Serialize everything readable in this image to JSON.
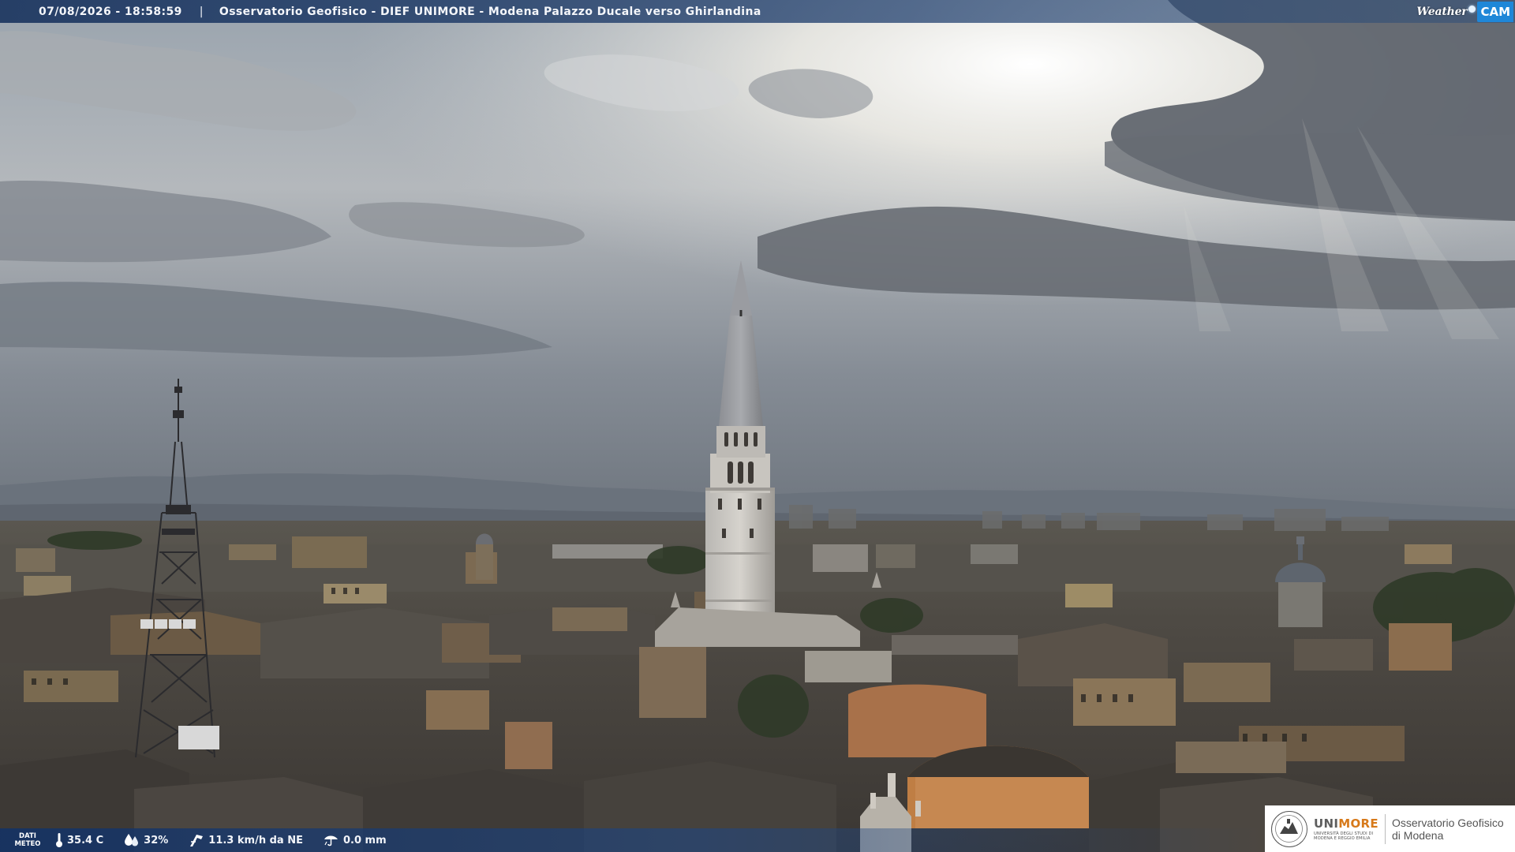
{
  "overlay": {
    "timestamp": "07/08/2026 - 18:58:59",
    "separator": "|",
    "camera_title": "Osservatorio Geofisico - DIEF UNIMORE - Modena Palazzo Ducale verso Ghirlandina"
  },
  "brand": {
    "weather": "Weather",
    "cam": "CAM"
  },
  "meteo": {
    "label_line1": "DATI",
    "label_line2": "METEO",
    "temperature": "35.4 C",
    "humidity": "32%",
    "wind": "11.3 km/h da NE",
    "rain": "0.0 mm"
  },
  "logo": {
    "uni_part1": "UNI",
    "uni_part2": "MORE",
    "uni_sub1": "Università degli studi di",
    "uni_sub2": "Modena e Reggio Emilia",
    "obs_line1": "Osservatorio Geofisico",
    "obs_line2": "di Modena"
  },
  "icons": {
    "temperature": "thermometer-icon",
    "humidity": "droplet-icon",
    "wind": "wind-icon",
    "rain": "rain-gauge-icon"
  },
  "colors": {
    "overlay_bar": "#1c3660",
    "cam_badge": "#1f87d8",
    "unimore_orange": "#d77a1b"
  }
}
